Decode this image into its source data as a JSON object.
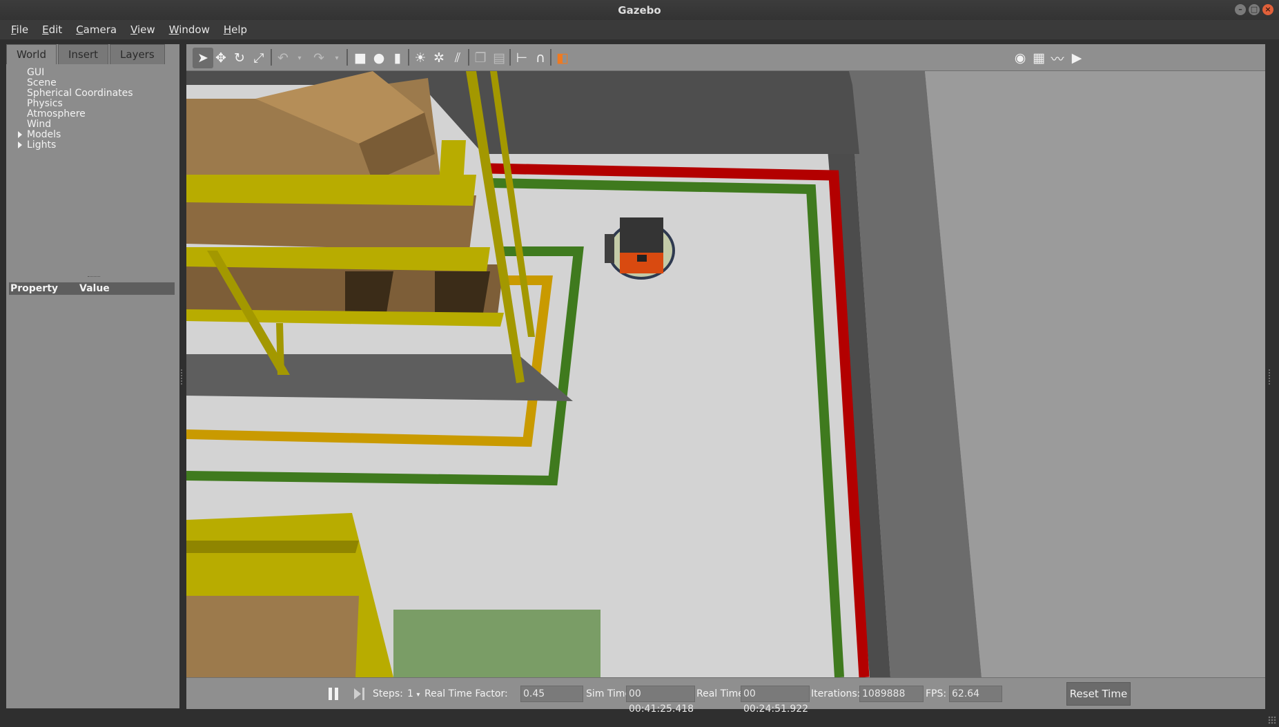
{
  "window": {
    "title": "Gazebo"
  },
  "menu": [
    "File",
    "Edit",
    "Camera",
    "View",
    "Window",
    "Help"
  ],
  "left_panel": {
    "tabs": [
      "World",
      "Insert",
      "Layers"
    ],
    "active_tab": "World",
    "tree": [
      "GUI",
      "Scene",
      "Spherical Coordinates",
      "Physics",
      "Atmosphere",
      "Wind",
      "Models",
      "Lights"
    ],
    "expandable": [
      "Models",
      "Lights"
    ],
    "property_header": {
      "property": "Property",
      "value": "Value"
    }
  },
  "toolbar": {
    "icons": [
      "select-mode-icon",
      "translate-mode-icon",
      "rotate-mode-icon",
      "scale-mode-icon",
      "undo-icon",
      "undo-history-icon",
      "redo-icon",
      "redo-history-icon",
      "box-shape-icon",
      "sphere-shape-icon",
      "cylinder-shape-icon",
      "point-light-icon",
      "spot-light-icon",
      "directional-light-icon",
      "copy-icon",
      "paste-icon",
      "align-icon",
      "snap-icon",
      "view-angle-icon",
      "screenshot-icon",
      "log-icon",
      "plot-icon",
      "video-record-icon"
    ]
  },
  "status": {
    "steps_label": "Steps:",
    "steps_value": "1",
    "rtf_label": "Real Time Factor:",
    "rtf_value": "0.45",
    "sim_time_label": "Sim Time:",
    "sim_time_value": "00 00:41:25.418",
    "real_time_label": "Real Time:",
    "real_time_value": "00 00:24:51.922",
    "iterations_label": "Iterations:",
    "iterations_value": "1089888",
    "fps_label": "FPS:",
    "fps_value": "62.64",
    "reset_label": "Reset Time"
  },
  "colors": {
    "shelf_yellow": "#b8ac00",
    "box_brown": "#9c7a4c",
    "line_red": "#b30000",
    "line_green": "#3f7a1e",
    "line_orange": "#c99a00",
    "robot_orange": "#d94a10"
  }
}
